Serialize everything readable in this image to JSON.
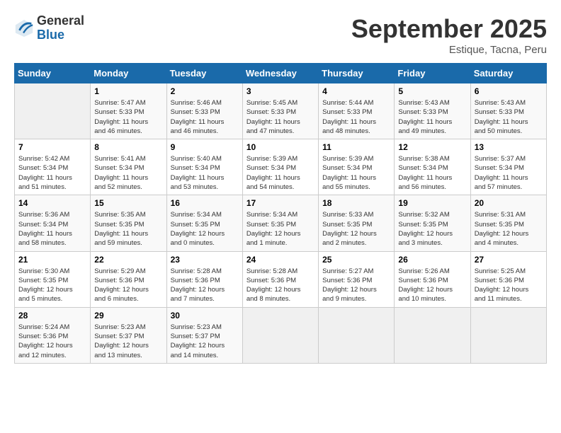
{
  "header": {
    "logo_general": "General",
    "logo_blue": "Blue",
    "month_title": "September 2025",
    "location": "Estique, Tacna, Peru"
  },
  "days_of_week": [
    "Sunday",
    "Monday",
    "Tuesday",
    "Wednesday",
    "Thursday",
    "Friday",
    "Saturday"
  ],
  "weeks": [
    [
      {
        "day": "",
        "info": ""
      },
      {
        "day": "1",
        "info": "Sunrise: 5:47 AM\nSunset: 5:33 PM\nDaylight: 11 hours\nand 46 minutes."
      },
      {
        "day": "2",
        "info": "Sunrise: 5:46 AM\nSunset: 5:33 PM\nDaylight: 11 hours\nand 46 minutes."
      },
      {
        "day": "3",
        "info": "Sunrise: 5:45 AM\nSunset: 5:33 PM\nDaylight: 11 hours\nand 47 minutes."
      },
      {
        "day": "4",
        "info": "Sunrise: 5:44 AM\nSunset: 5:33 PM\nDaylight: 11 hours\nand 48 minutes."
      },
      {
        "day": "5",
        "info": "Sunrise: 5:43 AM\nSunset: 5:33 PM\nDaylight: 11 hours\nand 49 minutes."
      },
      {
        "day": "6",
        "info": "Sunrise: 5:43 AM\nSunset: 5:33 PM\nDaylight: 11 hours\nand 50 minutes."
      }
    ],
    [
      {
        "day": "7",
        "info": "Sunrise: 5:42 AM\nSunset: 5:34 PM\nDaylight: 11 hours\nand 51 minutes."
      },
      {
        "day": "8",
        "info": "Sunrise: 5:41 AM\nSunset: 5:34 PM\nDaylight: 11 hours\nand 52 minutes."
      },
      {
        "day": "9",
        "info": "Sunrise: 5:40 AM\nSunset: 5:34 PM\nDaylight: 11 hours\nand 53 minutes."
      },
      {
        "day": "10",
        "info": "Sunrise: 5:39 AM\nSunset: 5:34 PM\nDaylight: 11 hours\nand 54 minutes."
      },
      {
        "day": "11",
        "info": "Sunrise: 5:39 AM\nSunset: 5:34 PM\nDaylight: 11 hours\nand 55 minutes."
      },
      {
        "day": "12",
        "info": "Sunrise: 5:38 AM\nSunset: 5:34 PM\nDaylight: 11 hours\nand 56 minutes."
      },
      {
        "day": "13",
        "info": "Sunrise: 5:37 AM\nSunset: 5:34 PM\nDaylight: 11 hours\nand 57 minutes."
      }
    ],
    [
      {
        "day": "14",
        "info": "Sunrise: 5:36 AM\nSunset: 5:34 PM\nDaylight: 11 hours\nand 58 minutes."
      },
      {
        "day": "15",
        "info": "Sunrise: 5:35 AM\nSunset: 5:35 PM\nDaylight: 11 hours\nand 59 minutes."
      },
      {
        "day": "16",
        "info": "Sunrise: 5:34 AM\nSunset: 5:35 PM\nDaylight: 12 hours\nand 0 minutes."
      },
      {
        "day": "17",
        "info": "Sunrise: 5:34 AM\nSunset: 5:35 PM\nDaylight: 12 hours\nand 1 minute."
      },
      {
        "day": "18",
        "info": "Sunrise: 5:33 AM\nSunset: 5:35 PM\nDaylight: 12 hours\nand 2 minutes."
      },
      {
        "day": "19",
        "info": "Sunrise: 5:32 AM\nSunset: 5:35 PM\nDaylight: 12 hours\nand 3 minutes."
      },
      {
        "day": "20",
        "info": "Sunrise: 5:31 AM\nSunset: 5:35 PM\nDaylight: 12 hours\nand 4 minutes."
      }
    ],
    [
      {
        "day": "21",
        "info": "Sunrise: 5:30 AM\nSunset: 5:35 PM\nDaylight: 12 hours\nand 5 minutes."
      },
      {
        "day": "22",
        "info": "Sunrise: 5:29 AM\nSunset: 5:36 PM\nDaylight: 12 hours\nand 6 minutes."
      },
      {
        "day": "23",
        "info": "Sunrise: 5:28 AM\nSunset: 5:36 PM\nDaylight: 12 hours\nand 7 minutes."
      },
      {
        "day": "24",
        "info": "Sunrise: 5:28 AM\nSunset: 5:36 PM\nDaylight: 12 hours\nand 8 minutes."
      },
      {
        "day": "25",
        "info": "Sunrise: 5:27 AM\nSunset: 5:36 PM\nDaylight: 12 hours\nand 9 minutes."
      },
      {
        "day": "26",
        "info": "Sunrise: 5:26 AM\nSunset: 5:36 PM\nDaylight: 12 hours\nand 10 minutes."
      },
      {
        "day": "27",
        "info": "Sunrise: 5:25 AM\nSunset: 5:36 PM\nDaylight: 12 hours\nand 11 minutes."
      }
    ],
    [
      {
        "day": "28",
        "info": "Sunrise: 5:24 AM\nSunset: 5:36 PM\nDaylight: 12 hours\nand 12 minutes."
      },
      {
        "day": "29",
        "info": "Sunrise: 5:23 AM\nSunset: 5:37 PM\nDaylight: 12 hours\nand 13 minutes."
      },
      {
        "day": "30",
        "info": "Sunrise: 5:23 AM\nSunset: 5:37 PM\nDaylight: 12 hours\nand 14 minutes."
      },
      {
        "day": "",
        "info": ""
      },
      {
        "day": "",
        "info": ""
      },
      {
        "day": "",
        "info": ""
      },
      {
        "day": "",
        "info": ""
      }
    ]
  ]
}
